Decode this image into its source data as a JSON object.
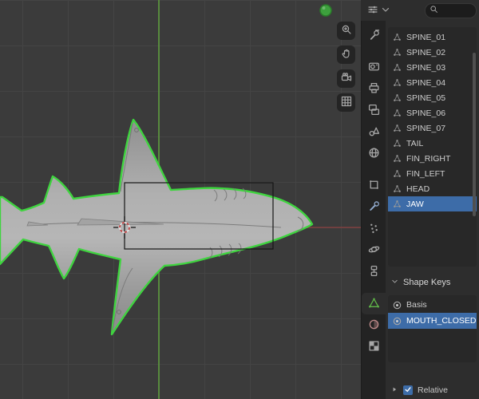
{
  "header": {
    "editor_icon": "properties-editor-icon",
    "editor_dropdown_icon": "chevron-down-icon",
    "search_icon": "search-icon",
    "search_value": ""
  },
  "viewport": {
    "tools": [
      {
        "id": "zoom",
        "icon": "zoom-icon"
      },
      {
        "id": "pan",
        "icon": "hand-icon"
      },
      {
        "id": "camera",
        "icon": "camera-icon"
      },
      {
        "id": "grid",
        "icon": "grid-icon"
      }
    ],
    "objects": {
      "selected_object": "shark",
      "nav_dot": "green-sphere"
    }
  },
  "properties_tabs": [
    {
      "id": "tool",
      "icon": "tool-icon"
    },
    {
      "id": "render",
      "icon": "render-icon",
      "gap": true
    },
    {
      "id": "output",
      "icon": "output-icon"
    },
    {
      "id": "view-layer",
      "icon": "view-layer-icon"
    },
    {
      "id": "scene",
      "icon": "scene-icon"
    },
    {
      "id": "world",
      "icon": "world-icon"
    },
    {
      "id": "object",
      "icon": "object-icon",
      "gap": true
    },
    {
      "id": "modifiers",
      "icon": "modifiers-icon"
    },
    {
      "id": "particles",
      "icon": "particles-icon"
    },
    {
      "id": "physics",
      "icon": "physics-icon"
    },
    {
      "id": "constraints",
      "icon": "constraints-icon"
    },
    {
      "id": "object-data",
      "icon": "object-data-icon",
      "selected": true,
      "gap": true
    },
    {
      "id": "material",
      "icon": "material-icon"
    },
    {
      "id": "texture",
      "icon": "texture-icon"
    }
  ],
  "vertex_groups": {
    "items": [
      {
        "label": "SPINE_01",
        "icon": "vertex-group-icon"
      },
      {
        "label": "SPINE_02",
        "icon": "vertex-group-icon"
      },
      {
        "label": "SPINE_03",
        "icon": "vertex-group-icon"
      },
      {
        "label": "SPINE_04",
        "icon": "vertex-group-icon"
      },
      {
        "label": "SPINE_05",
        "icon": "vertex-group-icon"
      },
      {
        "label": "SPINE_06",
        "icon": "vertex-group-icon"
      },
      {
        "label": "SPINE_07",
        "icon": "vertex-group-icon"
      },
      {
        "label": "TAIL",
        "icon": "vertex-group-icon"
      },
      {
        "label": "FIN_RIGHT",
        "icon": "vertex-group-icon"
      },
      {
        "label": "FIN_LEFT",
        "icon": "vertex-group-icon"
      },
      {
        "label": "HEAD",
        "icon": "vertex-group-icon"
      },
      {
        "label": "JAW",
        "icon": "vertex-group-icon",
        "selected": true
      }
    ]
  },
  "shape_keys": {
    "title": "Shape Keys",
    "collapse_icon": "chevron-down-icon",
    "items": [
      {
        "label": "Basis",
        "icon": "shape-key-icon"
      },
      {
        "label": "MOUTH_CLOSED",
        "icon": "shape-key-icon",
        "selected": true
      }
    ],
    "relative": {
      "label": "Relative",
      "checked": true
    },
    "expand_icon": "triangle-right-icon"
  },
  "colors": {
    "selection_outline": "#3fd43f",
    "selected_row": "#3d6ca8",
    "axis_green": "#5f9e3f",
    "axis_red": "#8a4040"
  }
}
